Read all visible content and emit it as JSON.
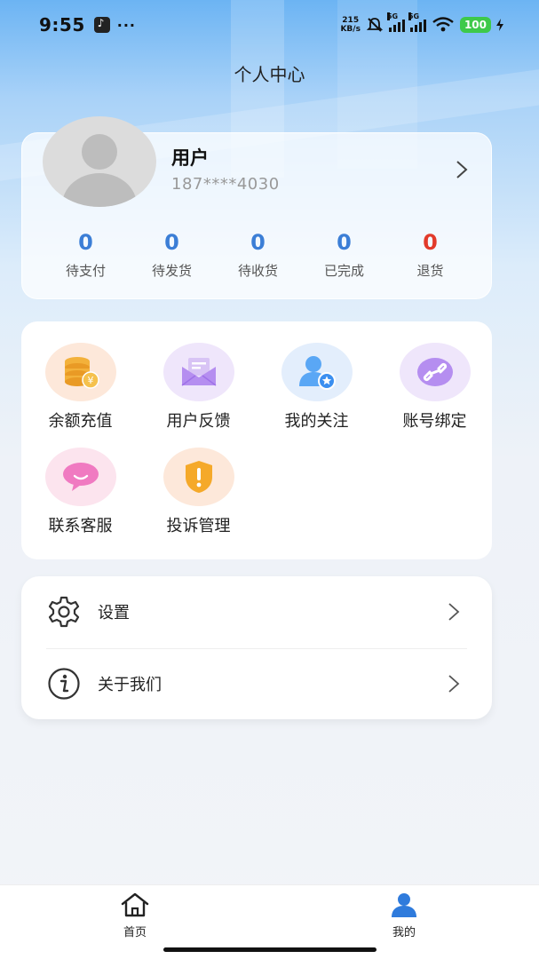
{
  "status_bar": {
    "time": "9:55",
    "dots": "···",
    "net_speed_value": "215",
    "net_speed_unit": "KB/s",
    "sim1_label": "5G",
    "sim2_label": "5G",
    "battery": "100"
  },
  "header": {
    "title": "个人中心"
  },
  "profile": {
    "name": "用户",
    "phone": "187****4030"
  },
  "order_stats": [
    {
      "count": "0",
      "label": "待支付",
      "color": "#3b7ed6"
    },
    {
      "count": "0",
      "label": "待发货",
      "color": "#3b7ed6"
    },
    {
      "count": "0",
      "label": "待收货",
      "color": "#3b7ed6"
    },
    {
      "count": "0",
      "label": "已完成",
      "color": "#3b7ed6"
    },
    {
      "count": "0",
      "label": "退货",
      "color": "#e23a2a"
    }
  ],
  "services": [
    {
      "label": "余额充值",
      "icon": "coins-icon"
    },
    {
      "label": "用户反馈",
      "icon": "mail-icon"
    },
    {
      "label": "我的关注",
      "icon": "user-star-icon"
    },
    {
      "label": "账号绑定",
      "icon": "link-icon"
    },
    {
      "label": "联系客服",
      "icon": "chat-bubble-icon"
    },
    {
      "label": "投诉管理",
      "icon": "shield-alert-icon"
    }
  ],
  "settings": [
    {
      "label": "设置",
      "icon": "gear-icon"
    },
    {
      "label": "关于我们",
      "icon": "info-icon"
    }
  ],
  "bottom_nav": [
    {
      "label": "首页",
      "icon": "home-icon",
      "active": false
    },
    {
      "label": "我的",
      "icon": "user-icon",
      "active": true
    }
  ],
  "colors": {
    "accent": "#3b7ed6",
    "refund": "#e23a2a",
    "nav_active": "#2f7bdc"
  }
}
